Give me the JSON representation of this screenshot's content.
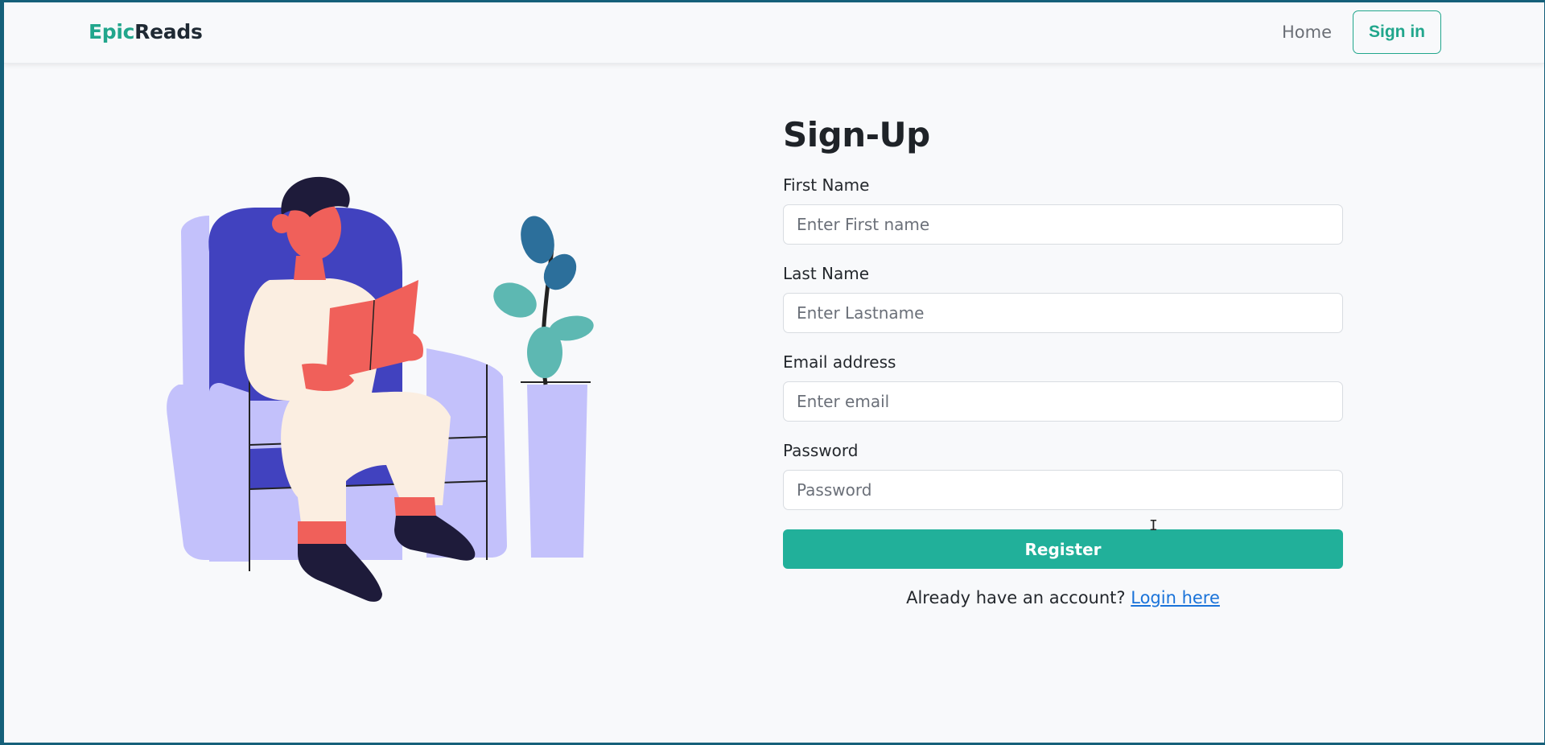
{
  "navbar": {
    "brand_accent": "Epic",
    "brand_rest": "Reads",
    "home_label": "Home",
    "signin_label": "Sign in"
  },
  "form": {
    "title": "Sign-Up",
    "first_name": {
      "label": "First Name",
      "placeholder": "Enter First name",
      "value": ""
    },
    "last_name": {
      "label": "Last Name",
      "placeholder": "Enter Lastname",
      "value": ""
    },
    "email": {
      "label": "Email address",
      "placeholder": "Enter email",
      "value": ""
    },
    "password": {
      "label": "Password",
      "placeholder": "Password",
      "value": ""
    },
    "register_label": "Register",
    "account_prompt": "Already have an account?",
    "login_link": "Login here"
  },
  "colors": {
    "accent": "#21a68c",
    "register_button": "#21b09a",
    "link": "#1a73d9",
    "chair_light": "#c3c1fb",
    "chair_dark": "#4142bf",
    "skin": "#f0605a",
    "plant": "#5db8b2"
  },
  "icons": {
    "illustration": "person-reading-in-armchair-illustration",
    "cursor": "text-cursor-icon"
  }
}
